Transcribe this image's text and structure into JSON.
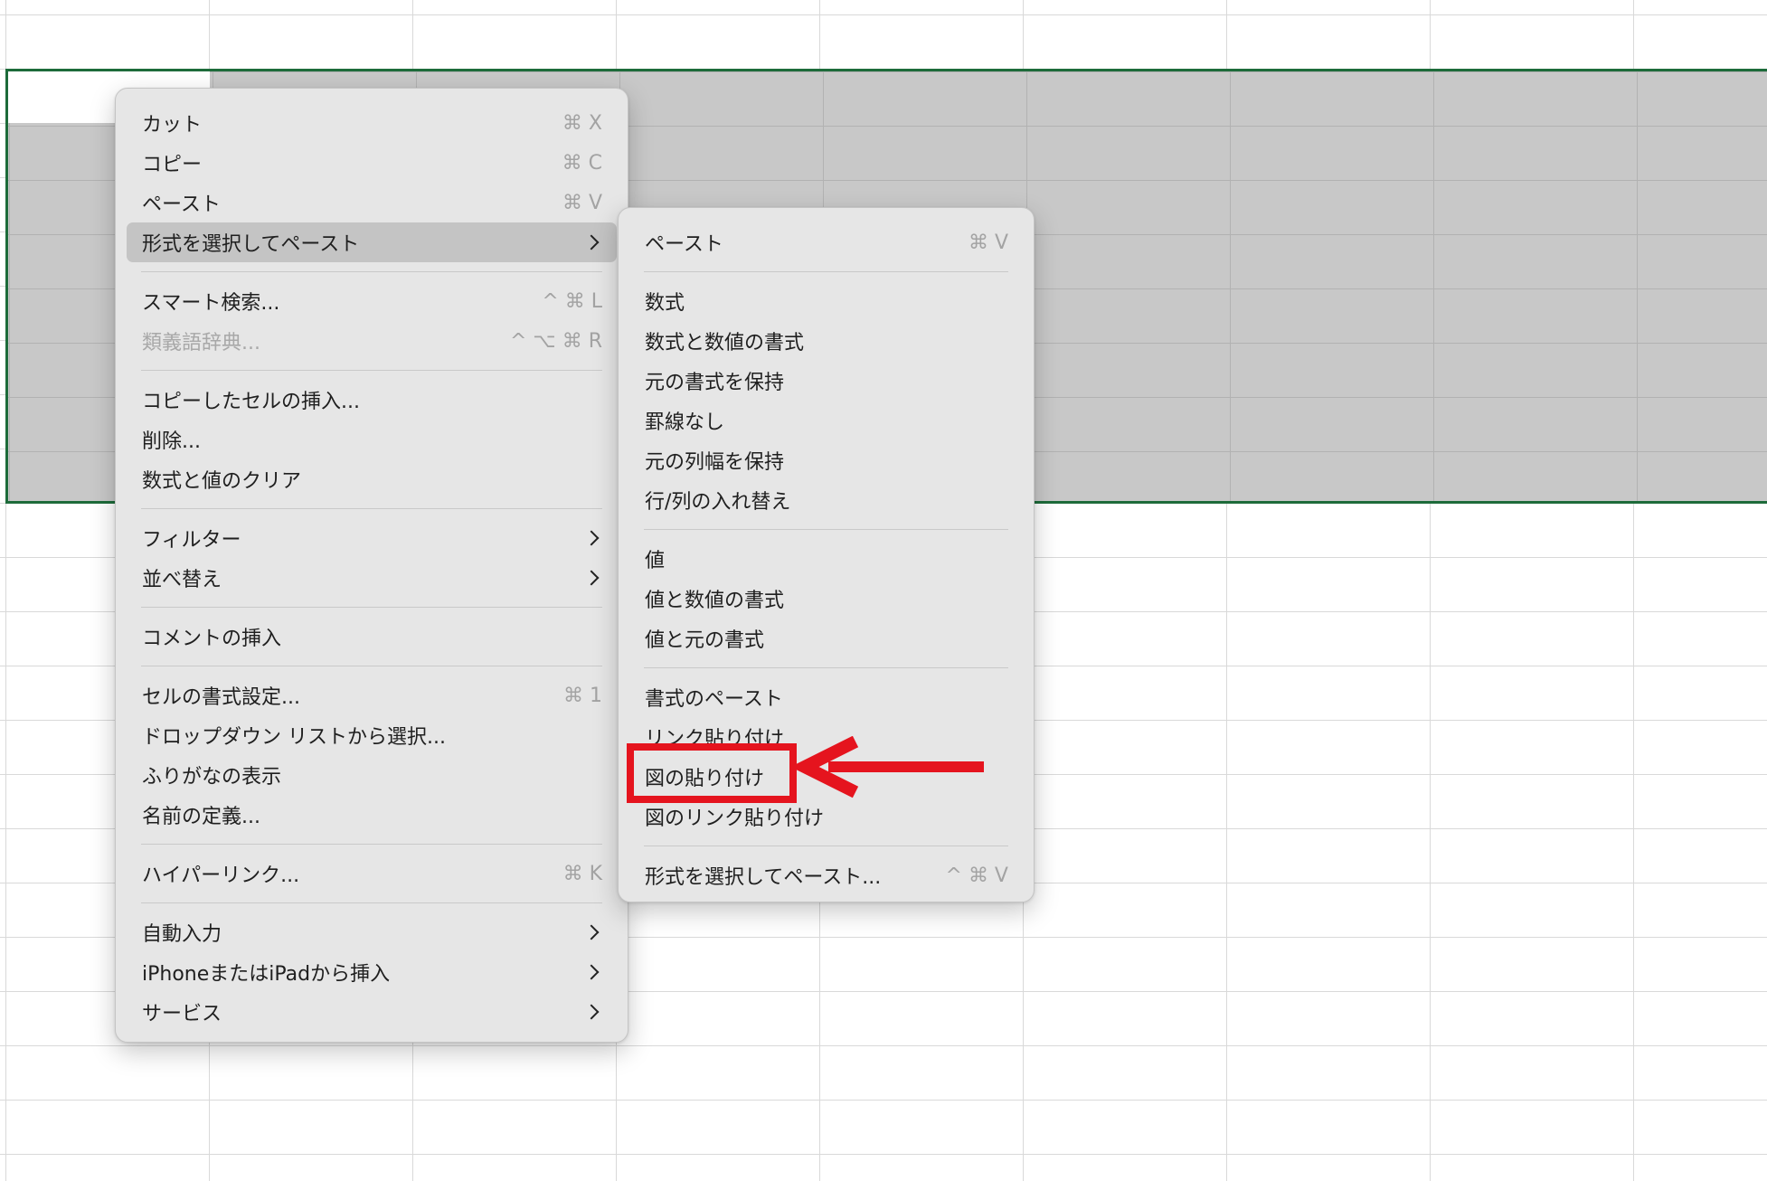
{
  "context_menu": {
    "items": [
      {
        "label": "カット",
        "shortcut": "⌘ X"
      },
      {
        "label": "コピー",
        "shortcut": "⌘ C"
      },
      {
        "label": "ペースト",
        "shortcut": "⌘ V"
      },
      {
        "label": "形式を選択してペースト",
        "shortcut": ""
      },
      {
        "label": "スマート検索...",
        "shortcut": "^ ⌘ L"
      },
      {
        "label": "類義語辞典...",
        "shortcut": "^ ⌥ ⌘ R"
      },
      {
        "label": "コピーしたセルの挿入...",
        "shortcut": ""
      },
      {
        "label": "削除...",
        "shortcut": ""
      },
      {
        "label": "数式と値のクリア",
        "shortcut": ""
      },
      {
        "label": "フィルター",
        "shortcut": ""
      },
      {
        "label": "並べ替え",
        "shortcut": ""
      },
      {
        "label": "コメントの挿入",
        "shortcut": ""
      },
      {
        "label": "セルの書式設定...",
        "shortcut": "⌘ 1"
      },
      {
        "label": "ドロップダウン リストから選択...",
        "shortcut": ""
      },
      {
        "label": "ふりがなの表示",
        "shortcut": ""
      },
      {
        "label": "名前の定義...",
        "shortcut": ""
      },
      {
        "label": "ハイパーリンク...",
        "shortcut": "⌘ K"
      },
      {
        "label": "自動入力",
        "shortcut": ""
      },
      {
        "label": "iPhoneまたはiPadから挿入",
        "shortcut": ""
      },
      {
        "label": "サービス",
        "shortcut": ""
      }
    ]
  },
  "paste_submenu": {
    "items": [
      {
        "label": "ペースト",
        "shortcut": "⌘ V"
      },
      {
        "label": "数式",
        "shortcut": ""
      },
      {
        "label": "数式と数値の書式",
        "shortcut": ""
      },
      {
        "label": "元の書式を保持",
        "shortcut": ""
      },
      {
        "label": "罫線なし",
        "shortcut": ""
      },
      {
        "label": "元の列幅を保持",
        "shortcut": ""
      },
      {
        "label": "行/列の入れ替え",
        "shortcut": ""
      },
      {
        "label": "値",
        "shortcut": ""
      },
      {
        "label": "値と数値の書式",
        "shortcut": ""
      },
      {
        "label": "値と元の書式",
        "shortcut": ""
      },
      {
        "label": "書式のペースト",
        "shortcut": ""
      },
      {
        "label": "リンク貼り付け",
        "shortcut": ""
      },
      {
        "label": "図の貼り付け",
        "shortcut": ""
      },
      {
        "label": "図のリンク貼り付け",
        "shortcut": ""
      },
      {
        "label": "形式を選択してペースト...",
        "shortcut": "^ ⌘ V"
      }
    ]
  },
  "colors": {
    "selection_border": "#1d6b3a",
    "annotation": "#e5141e",
    "menu_background": "#e6e6e6",
    "menu_highlight": "#c4c4c4"
  }
}
